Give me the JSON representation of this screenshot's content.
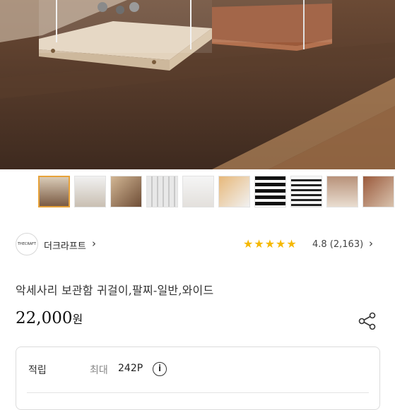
{
  "store": {
    "logo_text": "THECRAFT",
    "name": "더크라프트"
  },
  "rating": {
    "stars": 5,
    "score_text": "4.8 (2,163)"
  },
  "product": {
    "title": "악세사리 보관함 귀걸이,팔찌-일반,와이드",
    "price": "22,000",
    "currency": "원"
  },
  "points": {
    "label": "적립",
    "max_label": "최대",
    "value": "242P",
    "info_symbol": "i"
  },
  "thumbnails": {
    "count": 9,
    "active_index": 0
  },
  "icons": {
    "chevron": "›",
    "star": "★",
    "share": "share-icon",
    "info": "info-icon"
  },
  "colors": {
    "star": "#f5b800",
    "active_thumb": "#e7a23a"
  }
}
